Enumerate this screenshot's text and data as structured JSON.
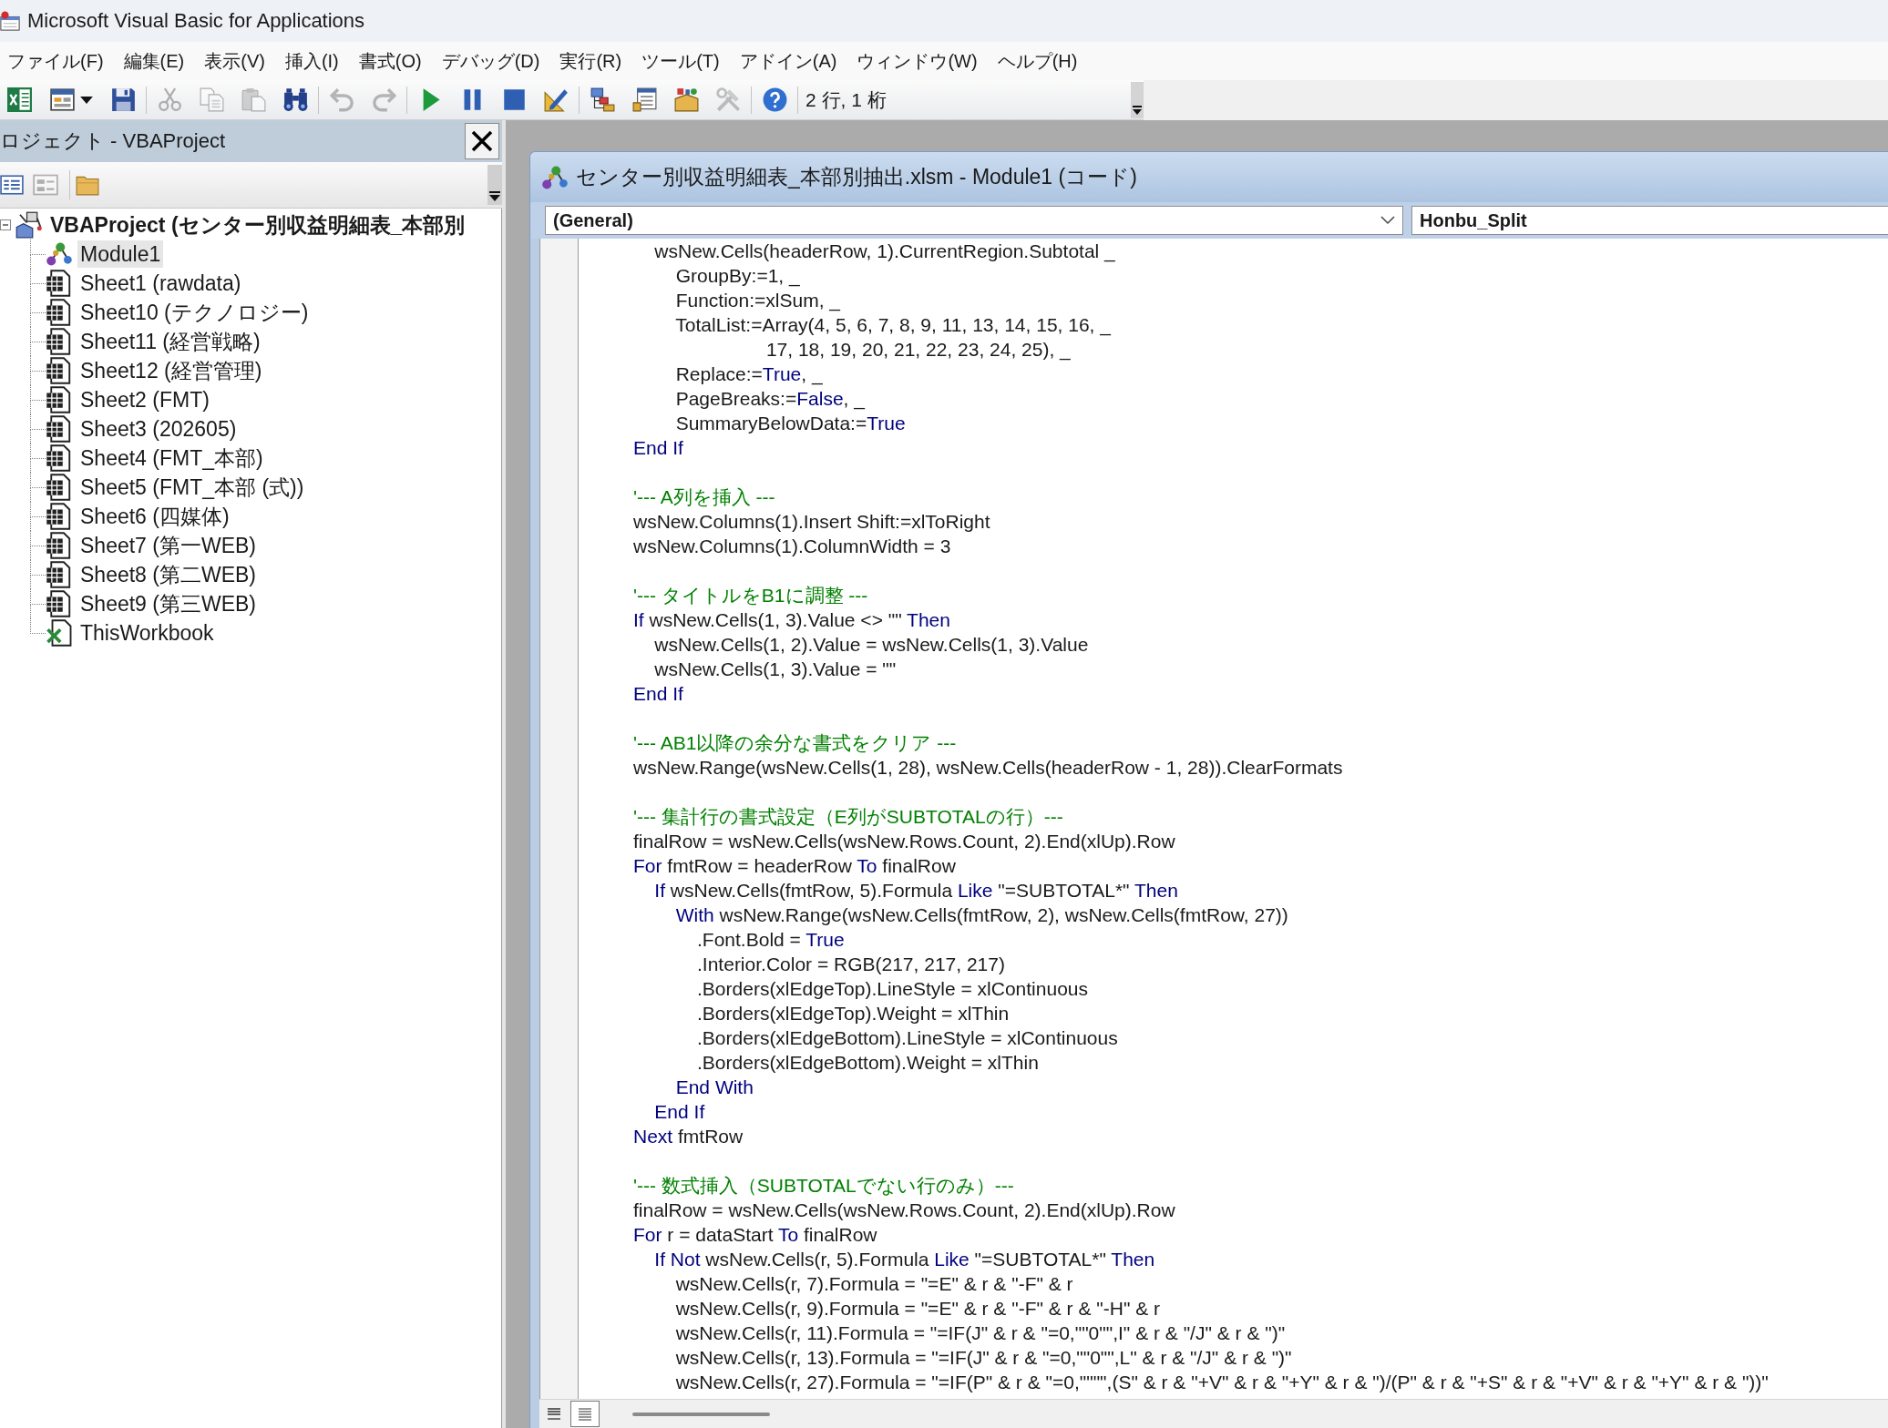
{
  "window": {
    "title": "Microsoft Visual Basic for Applications"
  },
  "menu": [
    "ファイル(F)",
    "編集(E)",
    "表示(V)",
    "挿入(I)",
    "書式(O)",
    "デバッグ(D)",
    "実行(R)",
    "ツール(T)",
    "アドイン(A)",
    "ウィンドウ(W)",
    "ヘルプ(H)"
  ],
  "toolbar": {
    "groups": [
      [
        {
          "kind": "excel",
          "disabled": false
        },
        {
          "kind": "userform",
          "disabled": false
        },
        {
          "kind": "save",
          "disabled": false
        }
      ],
      [
        {
          "kind": "cut",
          "disabled": true
        },
        {
          "kind": "copy",
          "disabled": true
        },
        {
          "kind": "paste",
          "disabled": true
        },
        {
          "kind": "find",
          "disabled": false
        }
      ],
      [
        {
          "kind": "undo",
          "disabled": true
        },
        {
          "kind": "redo",
          "disabled": true
        }
      ],
      [
        {
          "kind": "run",
          "disabled": false
        },
        {
          "kind": "pause",
          "disabled": false
        },
        {
          "kind": "stop",
          "disabled": false
        },
        {
          "kind": "design",
          "disabled": false
        }
      ],
      [
        {
          "kind": "explorer",
          "disabled": false
        },
        {
          "kind": "properties",
          "disabled": false
        },
        {
          "kind": "browser",
          "disabled": false
        },
        {
          "kind": "toolbox",
          "disabled": true
        }
      ],
      [
        {
          "kind": "help",
          "disabled": false
        }
      ]
    ],
    "position": "2 行, 1 桁"
  },
  "project_panel": {
    "title": "ロジェクト - VBAProject",
    "tools": [
      [
        {
          "kind": "code",
          "disabled": false
        },
        {
          "kind": "object",
          "disabled": true
        }
      ],
      [
        {
          "kind": "folders",
          "disabled": false
        }
      ]
    ],
    "tree": {
      "label": "VBAProject (センター別収益明細表_本部別",
      "kind": "project",
      "expanded": true,
      "selected": false,
      "children": [
        {
          "label": "Module1",
          "kind": "module",
          "selected": true
        },
        {
          "label": "Sheet1 (rawdata)",
          "kind": "sheet",
          "selected": false
        },
        {
          "label": "Sheet10 (テクノロジー)",
          "kind": "sheet",
          "selected": false
        },
        {
          "label": "Sheet11 (経営戦略)",
          "kind": "sheet",
          "selected": false
        },
        {
          "label": "Sheet12 (経営管理)",
          "kind": "sheet",
          "selected": false
        },
        {
          "label": "Sheet2 (FMT)",
          "kind": "sheet",
          "selected": false
        },
        {
          "label": "Sheet3 (202605)",
          "kind": "sheet",
          "selected": false
        },
        {
          "label": "Sheet4 (FMT_本部)",
          "kind": "sheet",
          "selected": false
        },
        {
          "label": "Sheet5 (FMT_本部 (式))",
          "kind": "sheet",
          "selected": false
        },
        {
          "label": "Sheet6 (四媒体)",
          "kind": "sheet",
          "selected": false
        },
        {
          "label": "Sheet7 (第一WEB)",
          "kind": "sheet",
          "selected": false
        },
        {
          "label": "Sheet8 (第二WEB)",
          "kind": "sheet",
          "selected": false
        },
        {
          "label": "Sheet9 (第三WEB)",
          "kind": "sheet",
          "selected": false
        },
        {
          "label": "ThisWorkbook",
          "kind": "workbook",
          "selected": false
        }
      ]
    }
  },
  "code_window": {
    "title": "センター別収益明細表_本部別抽出.xlsm - Module1 (コード)",
    "object_box": "(General)",
    "procedure_box": "Honbu_Split",
    "lines": [
      {
        "kind": "code",
        "spans": [
          {
            "kind": "plain",
            "text": "    wsNew.Cells(headerRow, 1).CurrentRegion.Subtotal _"
          }
        ]
      },
      {
        "kind": "code",
        "spans": [
          {
            "kind": "plain",
            "text": "        GroupBy:=1, _"
          }
        ]
      },
      {
        "kind": "code",
        "spans": [
          {
            "kind": "plain",
            "text": "        Function:=xlSum, _"
          }
        ]
      },
      {
        "kind": "code",
        "spans": [
          {
            "kind": "plain",
            "text": "        TotalList:=Array(4, 5, 6, 7, 8, 9, 11, 13, 14, 15, 16, _"
          }
        ]
      },
      {
        "kind": "code",
        "spans": [
          {
            "kind": "plain",
            "text": "                         17, 18, 19, 20, 21, 22, 23, 24, 25), _"
          }
        ]
      },
      {
        "kind": "code",
        "spans": [
          {
            "kind": "plain",
            "text": "        Replace:="
          },
          {
            "kind": "keyword",
            "text": "True"
          },
          {
            "kind": "plain",
            "text": ", _"
          }
        ]
      },
      {
        "kind": "code",
        "spans": [
          {
            "kind": "plain",
            "text": "        PageBreaks:="
          },
          {
            "kind": "keyword",
            "text": "False"
          },
          {
            "kind": "plain",
            "text": ", _"
          }
        ]
      },
      {
        "kind": "code",
        "spans": [
          {
            "kind": "plain",
            "text": "        SummaryBelowData:="
          },
          {
            "kind": "keyword",
            "text": "True"
          }
        ]
      },
      {
        "kind": "code",
        "spans": [
          {
            "kind": "keyword",
            "text": "End If"
          }
        ]
      },
      {
        "kind": "blank"
      },
      {
        "kind": "code",
        "spans": [
          {
            "kind": "comment",
            "text": "'--- A列を挿入 ---"
          }
        ]
      },
      {
        "kind": "code",
        "spans": [
          {
            "kind": "plain",
            "text": "wsNew.Columns(1).Insert Shift:=xlToRight"
          }
        ]
      },
      {
        "kind": "code",
        "spans": [
          {
            "kind": "plain",
            "text": "wsNew.Columns(1).ColumnWidth = 3"
          }
        ]
      },
      {
        "kind": "blank"
      },
      {
        "kind": "code",
        "spans": [
          {
            "kind": "comment",
            "text": "'--- タイトルをB1に調整 ---"
          }
        ]
      },
      {
        "kind": "code",
        "spans": [
          {
            "kind": "keyword",
            "text": "If"
          },
          {
            "kind": "plain",
            "text": " wsNew.Cells(1, 3).Value <> \"\" "
          },
          {
            "kind": "keyword",
            "text": "Then"
          }
        ]
      },
      {
        "kind": "code",
        "spans": [
          {
            "kind": "plain",
            "text": "    wsNew.Cells(1, 2).Value = wsNew.Cells(1, 3).Value"
          }
        ]
      },
      {
        "kind": "code",
        "spans": [
          {
            "kind": "plain",
            "text": "    wsNew.Cells(1, 3).Value = \"\""
          }
        ]
      },
      {
        "kind": "code",
        "spans": [
          {
            "kind": "keyword",
            "text": "End If"
          }
        ]
      },
      {
        "kind": "blank"
      },
      {
        "kind": "code",
        "spans": [
          {
            "kind": "comment",
            "text": "'--- AB1以降の余分な書式をクリア ---"
          }
        ]
      },
      {
        "kind": "code",
        "spans": [
          {
            "kind": "plain",
            "text": "wsNew.Range(wsNew.Cells(1, 28), wsNew.Cells(headerRow - 1, 28)).ClearFormats"
          }
        ]
      },
      {
        "kind": "blank"
      },
      {
        "kind": "code",
        "spans": [
          {
            "kind": "comment",
            "text": "'--- 集計行の書式設定（E列がSUBTOTALの行）---"
          }
        ]
      },
      {
        "kind": "code",
        "spans": [
          {
            "kind": "plain",
            "text": "finalRow = wsNew.Cells(wsNew.Rows.Count, 2).End(xlUp).Row"
          }
        ]
      },
      {
        "kind": "code",
        "spans": [
          {
            "kind": "keyword",
            "text": "For"
          },
          {
            "kind": "plain",
            "text": " fmtRow = headerRow "
          },
          {
            "kind": "keyword",
            "text": "To"
          },
          {
            "kind": "plain",
            "text": " finalRow"
          }
        ]
      },
      {
        "kind": "code",
        "spans": [
          {
            "kind": "keyword",
            "text": "    If"
          },
          {
            "kind": "plain",
            "text": " wsNew.Cells(fmtRow, 5).Formula "
          },
          {
            "kind": "keyword",
            "text": "Like"
          },
          {
            "kind": "plain",
            "text": " \"=SUBTOTAL*\" "
          },
          {
            "kind": "keyword",
            "text": "Then"
          }
        ]
      },
      {
        "kind": "code",
        "spans": [
          {
            "kind": "keyword",
            "text": "        With"
          },
          {
            "kind": "plain",
            "text": " wsNew.Range(wsNew.Cells(fmtRow, 2), wsNew.Cells(fmtRow, 27))"
          }
        ]
      },
      {
        "kind": "code",
        "spans": [
          {
            "kind": "plain",
            "text": "            .Font.Bold = "
          },
          {
            "kind": "keyword",
            "text": "True"
          }
        ]
      },
      {
        "kind": "code",
        "spans": [
          {
            "kind": "plain",
            "text": "            .Interior.Color = RGB(217, 217, 217)"
          }
        ]
      },
      {
        "kind": "code",
        "spans": [
          {
            "kind": "plain",
            "text": "            .Borders(xlEdgeTop).LineStyle = xlContinuous"
          }
        ]
      },
      {
        "kind": "code",
        "spans": [
          {
            "kind": "plain",
            "text": "            .Borders(xlEdgeTop).Weight = xlThin"
          }
        ]
      },
      {
        "kind": "code",
        "spans": [
          {
            "kind": "plain",
            "text": "            .Borders(xlEdgeBottom).LineStyle = xlContinuous"
          }
        ]
      },
      {
        "kind": "code",
        "spans": [
          {
            "kind": "plain",
            "text": "            .Borders(xlEdgeBottom).Weight = xlThin"
          }
        ]
      },
      {
        "kind": "code",
        "spans": [
          {
            "kind": "keyword",
            "text": "        End With"
          }
        ]
      },
      {
        "kind": "code",
        "spans": [
          {
            "kind": "keyword",
            "text": "    End If"
          }
        ]
      },
      {
        "kind": "code",
        "spans": [
          {
            "kind": "keyword",
            "text": "Next"
          },
          {
            "kind": "plain",
            "text": " fmtRow"
          }
        ]
      },
      {
        "kind": "blank"
      },
      {
        "kind": "code",
        "spans": [
          {
            "kind": "comment",
            "text": "'--- 数式挿入（SUBTOTALでない行のみ）---"
          }
        ]
      },
      {
        "kind": "code",
        "spans": [
          {
            "kind": "plain",
            "text": "finalRow = wsNew.Cells(wsNew.Rows.Count, 2).End(xlUp).Row"
          }
        ]
      },
      {
        "kind": "code",
        "spans": [
          {
            "kind": "keyword",
            "text": "For"
          },
          {
            "kind": "plain",
            "text": " r = dataStart "
          },
          {
            "kind": "keyword",
            "text": "To"
          },
          {
            "kind": "plain",
            "text": " finalRow"
          }
        ]
      },
      {
        "kind": "code",
        "spans": [
          {
            "kind": "keyword",
            "text": "    If Not"
          },
          {
            "kind": "plain",
            "text": " wsNew.Cells(r, 5).Formula "
          },
          {
            "kind": "keyword",
            "text": "Like"
          },
          {
            "kind": "plain",
            "text": " \"=SUBTOTAL*\" "
          },
          {
            "kind": "keyword",
            "text": "Then"
          }
        ]
      },
      {
        "kind": "code",
        "spans": [
          {
            "kind": "plain",
            "text": "        wsNew.Cells(r, 7).Formula = \"=E\" & r & \"-F\" & r"
          }
        ]
      },
      {
        "kind": "code",
        "spans": [
          {
            "kind": "plain",
            "text": "        wsNew.Cells(r, 9).Formula = \"=E\" & r & \"-F\" & r & \"-H\" & r"
          }
        ]
      },
      {
        "kind": "code",
        "spans": [
          {
            "kind": "plain",
            "text": "        wsNew.Cells(r, 11).Formula = \"=IF(J\" & r & \"=0,\"\"0\"\",I\" & r & \"/J\" & r & \")\""
          }
        ]
      },
      {
        "kind": "code",
        "spans": [
          {
            "kind": "plain",
            "text": "        wsNew.Cells(r, 13).Formula = \"=IF(J\" & r & \"=0,\"\"0\"\",L\" & r & \"/J\" & r & \")\""
          }
        ]
      },
      {
        "kind": "code",
        "spans": [
          {
            "kind": "plain",
            "text": "        wsNew.Cells(r, 27).Formula = \"=IF(P\" & r & \"=0,\"\"\"\",(S\" & r & \"+V\" & r & \"+Y\" & r & \")/(P\" & r & \"+S\" & r & \"+V\" & r & \"+Y\" & r & \"))\""
          }
        ]
      }
    ],
    "views": [
      {
        "kind": "procedure",
        "selected": false
      },
      {
        "kind": "module",
        "selected": true
      }
    ]
  }
}
